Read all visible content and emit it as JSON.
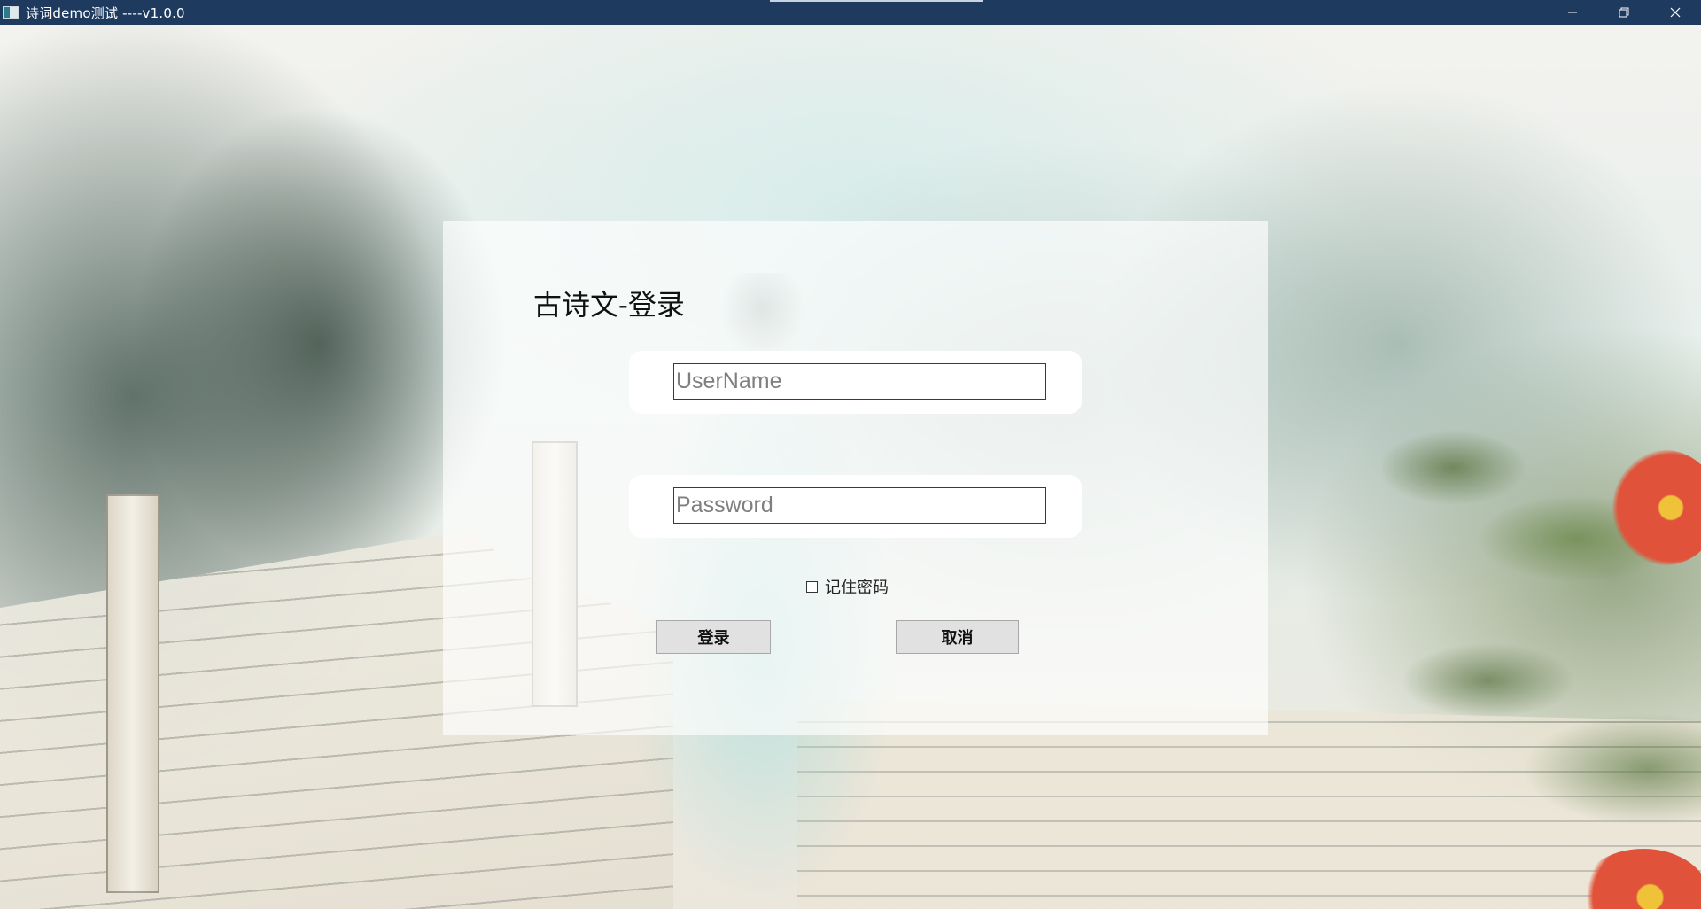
{
  "window": {
    "title": "诗词demo测试 ----v1.0.0",
    "icons": {
      "app": "app-icon",
      "minimize": "minimize-icon",
      "restore": "restore-icon",
      "close": "close-icon"
    },
    "titlebar_color": "#1f3a5f"
  },
  "login": {
    "title": "古诗文-登录",
    "username": {
      "placeholder": "UserName",
      "value": ""
    },
    "password": {
      "placeholder": "Password",
      "value": ""
    },
    "remember_label": "记住密码",
    "remember_checked": false,
    "login_button": "登录",
    "cancel_button": "取消"
  }
}
